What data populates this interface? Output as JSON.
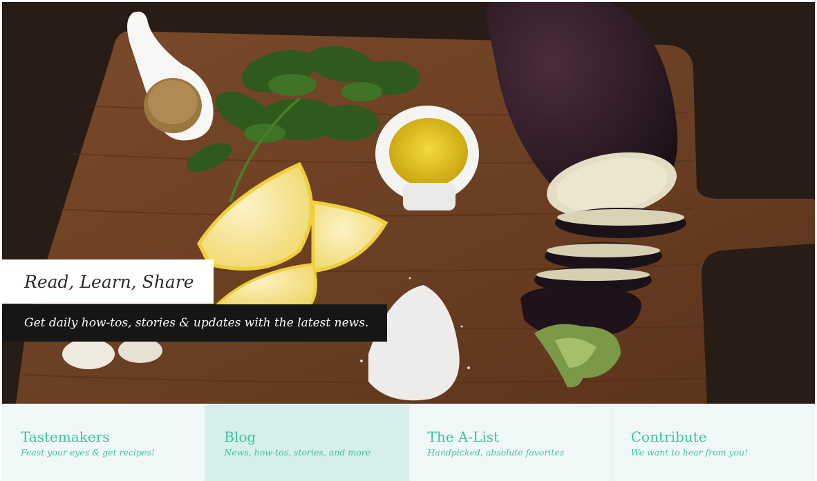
{
  "hero": {
    "title": "Read, Learn, Share",
    "subtitle": "Get daily how-tos, stories & updates with the latest news."
  },
  "nav": {
    "items": [
      {
        "title": "Tastemakers",
        "subtitle": "Feast your eyes & get recipes!",
        "active": false
      },
      {
        "title": "Blog",
        "subtitle": "News, how-tos, stories, and more",
        "active": true
      },
      {
        "title": "The A-List",
        "subtitle": "Handpicked, absolute favorites",
        "active": false
      },
      {
        "title": "Contribute",
        "subtitle": "We want to hear from you!",
        "active": false
      }
    ]
  },
  "colors": {
    "accent": "#3fbfa1",
    "tile_bg": "#eff8f6",
    "tile_active_bg": "#d6efea",
    "caption_dark": "#161616"
  },
  "icons": [
    "hero-food-photo"
  ]
}
